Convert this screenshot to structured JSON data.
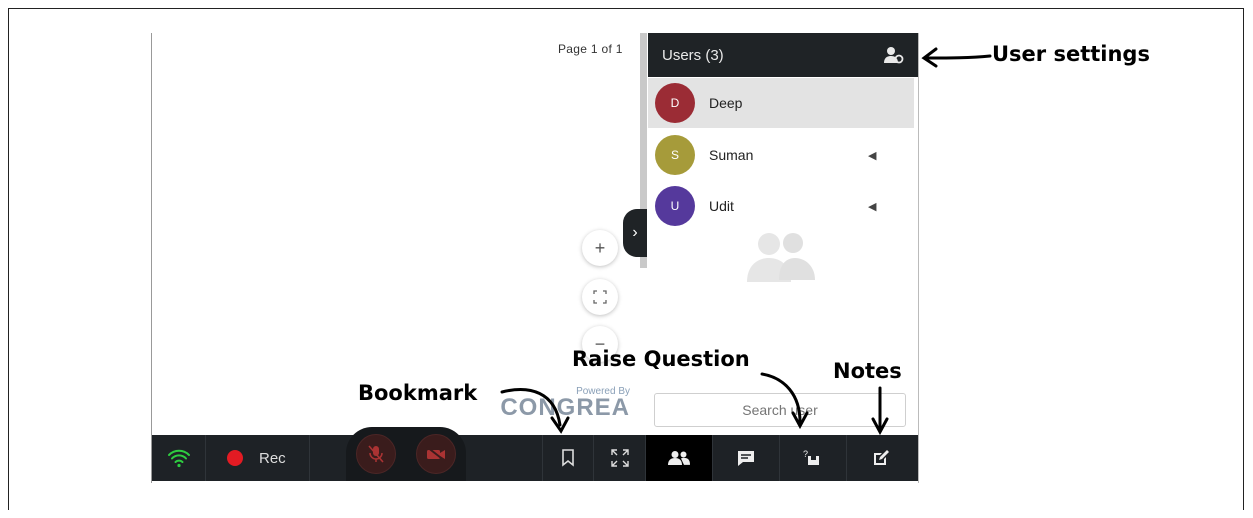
{
  "page_indicator": "Page 1 of 1",
  "users_panel": {
    "title": "Users (3)",
    "users": [
      {
        "initial": "D",
        "name": "Deep",
        "color": "#9b2c35",
        "active": true
      },
      {
        "initial": "S",
        "name": "Suman",
        "color": "#a69b3a",
        "active": false
      },
      {
        "initial": "U",
        "name": "Udit",
        "color": "#55399c",
        "active": false
      }
    ],
    "search_placeholder": "Search user"
  },
  "branding": {
    "powered_by": "Powered By",
    "brand": "CONGREA"
  },
  "toolbar": {
    "rec_label": "Rec"
  },
  "annotations": {
    "user_settings": "User settings",
    "bookmark": "Bookmark",
    "raise_question": "Raise Question",
    "notes": "Notes"
  },
  "colors": {
    "bar": "#1e2226",
    "rec": "#e31b23",
    "wifi": "#2ecc40"
  }
}
